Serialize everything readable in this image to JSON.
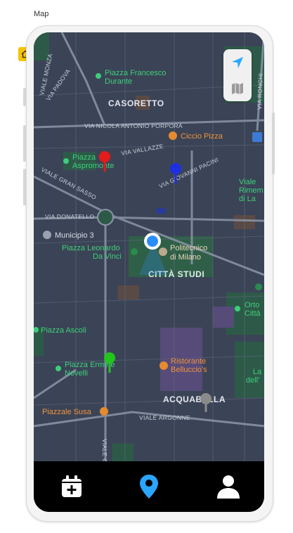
{
  "frame": {
    "title": "Map"
  },
  "map": {
    "streets": [
      "VIA PADOVA",
      "VIALE MONZA",
      "VIA NICOLA ANTONIO PORPORA",
      "VIA VALLAZZE",
      "VIALE GRAN SASSO",
      "VIA GIOVANNI PACINI",
      "VIA DONATELLO",
      "VIALE ARGONNE",
      "VIA RONCHI",
      "VIALE C"
    ],
    "districts": [
      "CASORETTO",
      "CITTÀ STUDI",
      "ACQUABELLA"
    ],
    "places": {
      "piazza_durante": [
        "Piazza Francesco",
        "Durante"
      ],
      "ciccio_pizza": "Ciccio Pizza",
      "piazza_aspromonte": [
        "Piazza",
        "Aspromonte"
      ],
      "municipio": "Municipio 3",
      "piazza_leonardo": [
        "Piazza Leonardo",
        "Da Vinci"
      ],
      "politecnico": [
        "Politecnico",
        "di Milano"
      ],
      "piazza_ascoli": "Piazza Ascoli",
      "piazza_novelli": [
        "Piazza Ermete",
        "Novelli"
      ],
      "ristorante": [
        "Ristorante",
        "Belluccio's"
      ],
      "piazzale_susa": "Piazzale Susa",
      "viale_rimem": [
        "Viale",
        "Rimem",
        "di La"
      ],
      "orto": [
        "Orto",
        "Città"
      ],
      "la_dell": [
        "La",
        "dell'"
      ]
    },
    "pins": [
      {
        "color": "#e41b1b"
      },
      {
        "color": "#1d2fe0"
      },
      {
        "color": "#22c41e"
      },
      {
        "color": "#8a8a8a"
      }
    ],
    "colors": {
      "street_label": "#c9cfdb",
      "place_label": "#3ccf7a",
      "poi_label": "#f0923a",
      "user": "#2b8cff"
    }
  },
  "controls": {
    "locate_icon": "navigation-arrow-icon",
    "map_type_icon": "map-icon"
  },
  "tabbar": {
    "items": [
      {
        "icon": "calendar-add-icon",
        "color": "#ffffff"
      },
      {
        "icon": "location-pin-icon",
        "color": "#2aa6ff"
      },
      {
        "icon": "user-icon",
        "color": "#ffffff"
      }
    ]
  }
}
